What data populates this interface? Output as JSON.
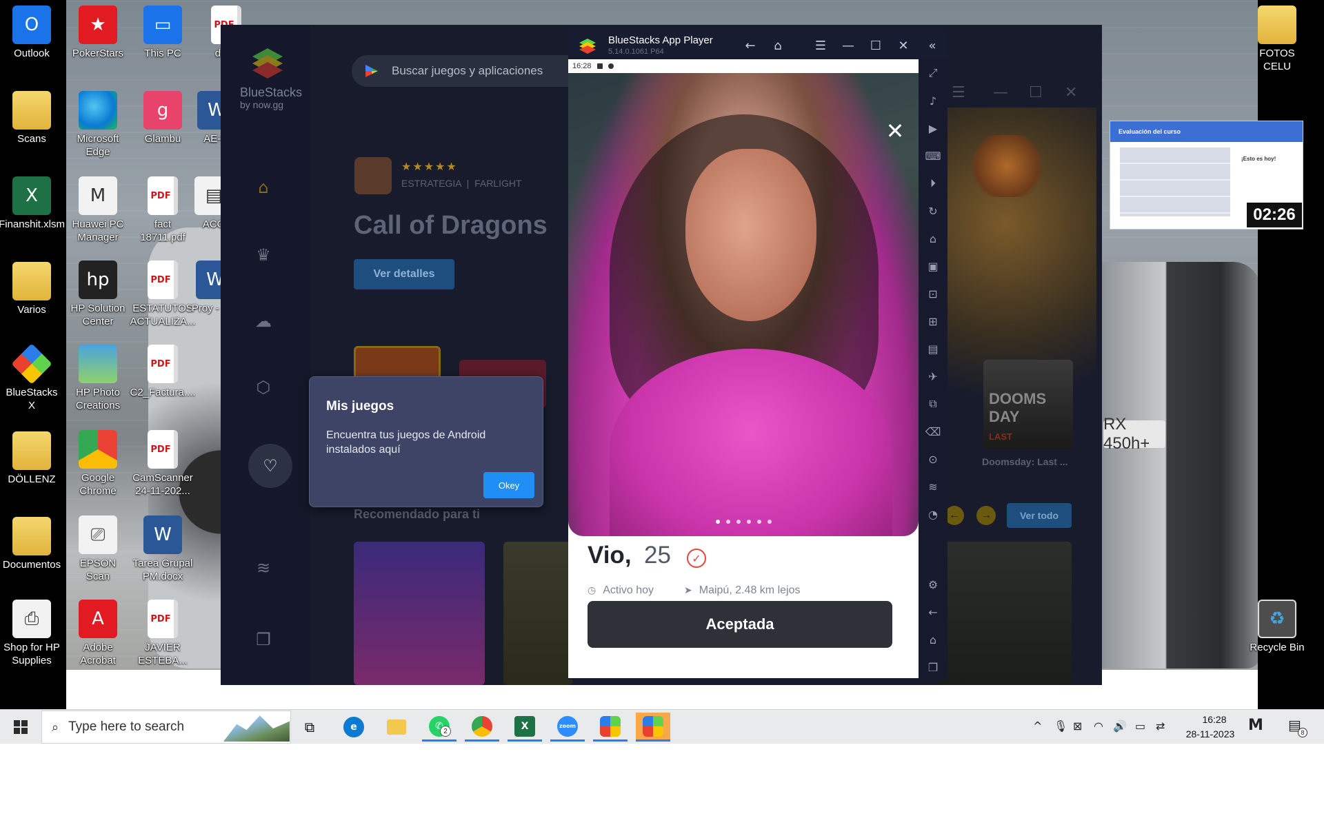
{
  "desktop": {
    "icons_left": [
      {
        "label": "Outlook",
        "icon": "outlook-icon"
      },
      {
        "label": "Scans",
        "icon": "folder-icon"
      },
      {
        "label": "Finanshit.xlsm",
        "icon": "excel-file-icon"
      },
      {
        "label": "Varios",
        "icon": "folder-icon"
      },
      {
        "label": "BlueStacks X",
        "icon": "bluestacks-icon"
      },
      {
        "label": "DÖLLENZ",
        "icon": "folder-icon"
      },
      {
        "label": "Documentos",
        "icon": "folder-icon"
      },
      {
        "label": "Shop for HP Supplies",
        "icon": "printer-icon"
      }
    ],
    "icons_second": [
      {
        "label": "PokerStars",
        "icon": "pokerstars-icon"
      },
      {
        "label": "Microsoft Edge",
        "icon": "edge-icon"
      },
      {
        "label": "Huawei PC Manager",
        "icon": "huawei-pc-manager-icon"
      },
      {
        "label": "HP Solution Center",
        "icon": "hp-icon"
      },
      {
        "label": "HP Photo Creations",
        "icon": "photo-icon"
      },
      {
        "label": "Google Chrome",
        "icon": "chrome-icon"
      },
      {
        "label": "EPSON Scan",
        "icon": "scanner-icon"
      },
      {
        "label": "Adobe Acrobat",
        "icon": "acrobat-icon"
      }
    ],
    "icons_third": [
      {
        "label": "This PC",
        "icon": "computer-icon"
      },
      {
        "label": "Glambu",
        "icon": "glambu-icon"
      },
      {
        "label": "fact 18711.pdf",
        "icon": "pdf-icon"
      },
      {
        "label": "ESTATUTOS ACTUALIZA...",
        "icon": "pdf-icon"
      },
      {
        "label": "C2_Factura....",
        "icon": "pdf-icon"
      },
      {
        "label": "CamScanner 24-11-202...",
        "icon": "pdf-icon"
      },
      {
        "label": "Tarea Grupal PM.docx",
        "icon": "word-icon"
      },
      {
        "label": "JAVIER ESTEBA...",
        "icon": "pdf-icon"
      }
    ],
    "icons_fourth_partial": [
      {
        "label": "docu",
        "icon": "pdf-icon"
      },
      {
        "label": "AE-fa",
        "icon": "word-icon"
      },
      {
        "label": "ACO",
        "icon": "document-icon"
      },
      {
        "label": "Proy - Cur",
        "icon": "word-icon"
      }
    ],
    "icons_right": [
      {
        "label": "FOTOS CELU",
        "icon": "folder-icon"
      },
      {
        "label": "Recycle Bin",
        "icon": "recycle-bin-icon"
      }
    ],
    "car_plate": "RX 450h+"
  },
  "launcher": {
    "brand": "BlueStacks",
    "brand_sub": "by now.gg",
    "search_placeholder": "Buscar juegos y aplicaciones",
    "featured": {
      "stars": "★★★★★",
      "genre": "ESTRATEGIA",
      "publisher": "FARLIGHT",
      "title": "Call of Dragons",
      "details_button": "Ver detalles"
    },
    "recommended_title": "Recomendado para ti",
    "see_all": "Ver todo",
    "game_card_label": "Doomsday: Last ...",
    "game_card_art": "DOOMS DAY",
    "game_card_art_sub": "LAST"
  },
  "tooltip": {
    "title": "Mis juegos",
    "body": "Encuentra tus juegos de Android instalados aquí",
    "ok_button": "Okey"
  },
  "player": {
    "title": "BlueStacks App Player",
    "version": "5.14.0.1061 P64",
    "status_time": "16:28",
    "profile": {
      "name": "Vio,",
      "age": "25",
      "active": "Activo hoy",
      "location": "Maipú, 2.48 km lejos",
      "accept_button": "Aceptada",
      "photo_count": 6,
      "photo_index": 1
    }
  },
  "video_overlay": {
    "header": "Evaluación del curso",
    "note": "¡Esto es hoy!",
    "timer": "02:26"
  },
  "taskbar": {
    "search_placeholder": "Type here to search",
    "whatsapp_badge": "2",
    "zoom_label": "zoom",
    "clock_time": "16:28",
    "clock_date": "28-11-2023",
    "notifications_badge": "8"
  }
}
